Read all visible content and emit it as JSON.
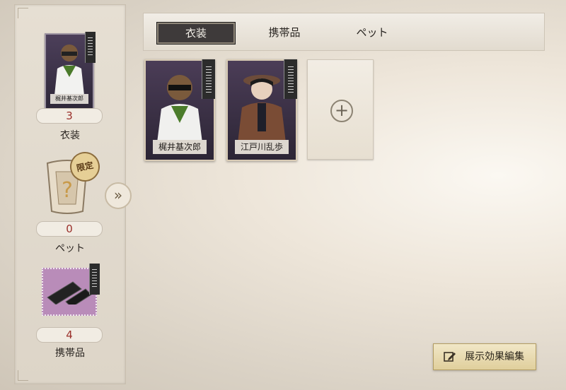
{
  "left_panel": {
    "costume": {
      "card_name": "梶井基次郎",
      "count": "3",
      "label": "衣装"
    },
    "pet": {
      "badge": "限定",
      "count": "0",
      "label": "ペット"
    },
    "item": {
      "count": "4",
      "label": "携帯品"
    }
  },
  "tabs": [
    {
      "label": "衣装",
      "active": true
    },
    {
      "label": "携帯品",
      "active": false
    },
    {
      "label": "ペット",
      "active": false
    }
  ],
  "cards": [
    {
      "name": "梶井基次郎"
    },
    {
      "name": "江戸川乱歩"
    }
  ],
  "expand_icon": "double-chevron-right",
  "add_icon": "plus",
  "edit_button": {
    "label": "展示効果編集",
    "icon": "edit-icon"
  },
  "colors": {
    "count_text": "#9a2f2a",
    "active_tab": "#3e3a3a"
  }
}
